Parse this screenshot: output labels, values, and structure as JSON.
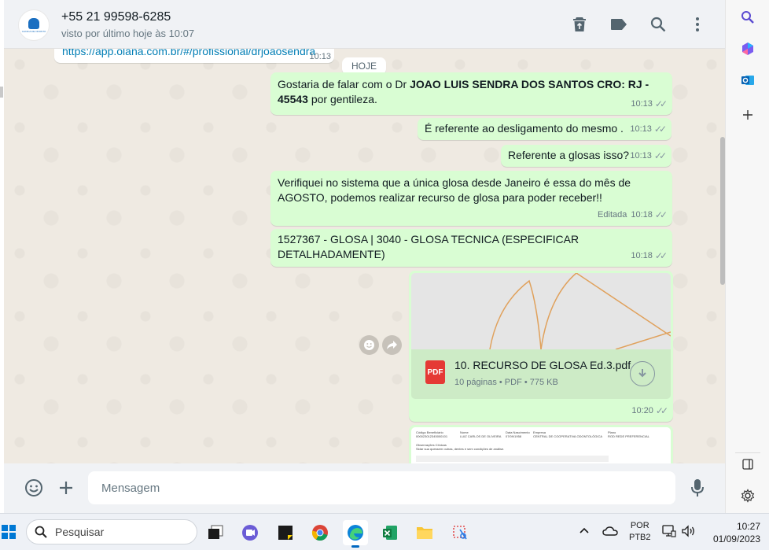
{
  "chat": {
    "contact_name": "+55 21 99598-6285",
    "contact_status": "visto por último hoje às 10:07",
    "avatar_text": "CLINICA DE ODONTO",
    "header_icons": [
      "delete-icon",
      "label-icon",
      "search-icon",
      "menu-icon"
    ]
  },
  "messages": {
    "link": {
      "text": "https://app.olana.com.br/#/profissional/drjoaosendra",
      "time": "10:13"
    },
    "date_chip": "HOJE",
    "m1": {
      "prefix": "Gostaria de falar com o Dr ",
      "bold1": "JOAO LUIS SENDRA DOS SANTOS CRO: RJ - 45543",
      "suffix": " por gentileza.",
      "time": "10:13"
    },
    "m2": {
      "text": "É referente ao desligamento do mesmo .",
      "time": "10:13"
    },
    "m3": {
      "text": "Referente a glosas isso?",
      "time": "10:13"
    },
    "m4": {
      "text": "Verifiquei no sistema que a única glosa desde Janeiro é essa do mês de AGOSTO, podemos realizar  recurso de glosa para poder receber!!",
      "edited": "Editada",
      "time": "10:18"
    },
    "m5": {
      "text": "1527367 - GLOSA | 3040 - GLOSA TECNICA (ESPECIFICAR DETALHADAMENTE)",
      "time": "10:18"
    },
    "doc": {
      "icon_label": "PDF",
      "name": "10. RECURSO DE GLOSA Ed.3.pdf",
      "info": "10 páginas • PDF • 775 KB",
      "time": "10:20"
    },
    "doc2_preview": {
      "col1_label": "Código Beneficiário",
      "col1_value": "000023012345000101",
      "col2_label": "Nome",
      "col2_value": "LUIZ CARLOS DE OLIVEIRA",
      "col3_label": "Data Nascimento",
      "col3_value": "07/09/1958",
      "col4_label": "Empresa",
      "col4_value": "CENTRAL DE COOPERATIVA ODONTOLÓGICA",
      "col5_label": "Plano",
      "col5_value": "ROD REDE PREFERENCIAL",
      "obs_label": "Observações Clínicas",
      "obs_value": "Sidar sua quessem outras, dentes e sem condições de análise."
    }
  },
  "composer": {
    "placeholder": "Mensagem"
  },
  "side_panel": {
    "icons": [
      "search-icon",
      "copilot-icon",
      "outlook-icon",
      "add-icon",
      "sidebar-toggle-icon",
      "settings-icon"
    ]
  },
  "taskbar": {
    "search_label": "Pesquisar",
    "lang_line1": "POR",
    "lang_line2": "PTB2",
    "time": "10:27",
    "date": "01/09/2023"
  },
  "colors": {
    "bubble_out": "#d9fdd3",
    "chat_bg": "#efeae2",
    "link": "#027eb5",
    "pdf_red": "#e53935"
  }
}
